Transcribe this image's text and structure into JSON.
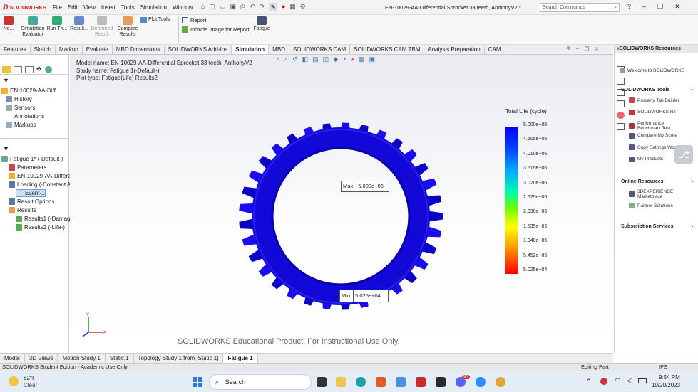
{
  "app": {
    "logo": "SOLIDWORKS",
    "doc_title": "EN-10029-AA-Differential Sprocket 33 teeth, AnthonyV2 *",
    "search_placeholder": "Search Commands",
    "menus": [
      "File",
      "Edit",
      "View",
      "Insert",
      "Tools",
      "Simulation",
      "Window"
    ]
  },
  "ribbon": {
    "buttons": [
      {
        "label": "Ne...",
        "name": "new"
      },
      {
        "label": "Simulation Evaluator",
        "name": "simulation-evaluator"
      },
      {
        "label": "Run Th...",
        "name": "run-this-study"
      },
      {
        "label": "Result...",
        "name": "results-advisor"
      },
      {
        "label": "Deformed Result",
        "name": "deformed-result"
      },
      {
        "label": "Compare Results",
        "name": "compare-results"
      }
    ],
    "plot_tools": "Plot Tools",
    "report": "Report",
    "include_image": "Include Image for Report",
    "fatigue": "Fatigue"
  },
  "cmd_tabs": [
    "Features",
    "Sketch",
    "Markup",
    "Evaluate",
    "MBD Dimensions",
    "SOLIDWORKS Add-Ins",
    "Simulation",
    "MBD",
    "SOLIDWORKS CAM",
    "SOLIDWORKS CAM TBM",
    "Analysis Preparation",
    "CAM"
  ],
  "active_cmd_tab": "Simulation",
  "tree_top": [
    {
      "label": "EN-10029-AA-Diff"
    },
    {
      "label": "History"
    },
    {
      "label": "Sensors"
    },
    {
      "label": "Annotations"
    },
    {
      "label": "Markups"
    }
  ],
  "tree_sim": [
    {
      "label": "Fatigue 1* (-Default-)"
    },
    {
      "label": "Parameters"
    },
    {
      "label": "EN-10029-AA-Differe"
    },
    {
      "label": "Loading (-Constant A"
    },
    {
      "label": "Event-1"
    },
    {
      "label": "Result Options"
    },
    {
      "label": "Results"
    },
    {
      "label": "Results1 (-Damag"
    },
    {
      "label": "Results2 (-Life-)"
    }
  ],
  "viewport": {
    "model_name": "Model name: EN-10029-AA-Differential Sprocket 33 teeth, AnthonyV2",
    "study_name": "Study name: Fatigue 1(-Default-)",
    "plot_type": "Plot type: Fatigue(Life) Results2",
    "max_label": "Max:",
    "max_value": "5.000e+06",
    "min_label": "Min:",
    "min_value": "5.025e+04",
    "watermark": "SOLIDWORKS Educational Product. For Instructional Use Only.",
    "axis_y": "Y",
    "axis_x": "X"
  },
  "legend": {
    "title": "Total Life (cycle)",
    "ticks": [
      "5.000e+06",
      "4.505e+06",
      "4.010e+06",
      "3.515e+06",
      "3.020e+06",
      "2.525e+06",
      "2.030e+06",
      "1.535e+06",
      "1.040e+06",
      "5.452e+05",
      "5.025e+04"
    ]
  },
  "right_panel": {
    "title": "SOLIDWORKS Resources",
    "welcome": "Welcome to SOLIDWORKS",
    "tools_header": "SOLIDWORKS Tools",
    "tools": [
      "Property Tab Builder",
      "SOLIDWORKS Rx",
      "Performance Benchmark Test",
      "Compare My Score",
      "Copy Settings Wizard",
      "My Products"
    ],
    "online_header": "Online Resources",
    "online": [
      "3DEXPERIENCE Marketplace",
      "Partner Solutions"
    ],
    "subscription_header": "Subscription Services"
  },
  "bottom_tabs": [
    "Model",
    "3D Views",
    "Motion Study 1",
    "Static 1",
    "Topology Study 1 from [Static 1]",
    "Fatigue 1"
  ],
  "active_bottom_tab": "Fatigue 1",
  "status": {
    "left": "SOLIDWORKS Student Edition - Academic Use Only",
    "mode": "Editing Part",
    "units": "IPS"
  },
  "taskbar": {
    "temp": "62°F",
    "weather": "Clear",
    "search": "Search",
    "time": "9:54 PM",
    "date": "10/20/2023",
    "badge": "9+"
  }
}
